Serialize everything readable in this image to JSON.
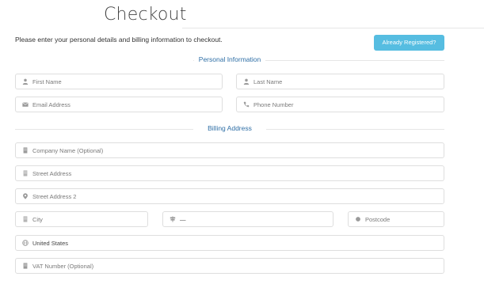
{
  "page": {
    "title": "Checkout",
    "intro": "Please enter your personal details and billing information to checkout.",
    "registered_button": "Already Registered?"
  },
  "sections": {
    "personal": "Personal Information",
    "billing": "Billing Address"
  },
  "fields": {
    "first_name": {
      "placeholder": "First Name",
      "icon": "user-icon"
    },
    "last_name": {
      "placeholder": "Last Name",
      "icon": "user-icon"
    },
    "email": {
      "placeholder": "Email Address",
      "icon": "envelope-icon"
    },
    "phone": {
      "placeholder": "Phone Number",
      "icon": "phone-icon"
    },
    "company": {
      "placeholder": "Company Name (Optional)",
      "icon": "building-icon"
    },
    "street": {
      "placeholder": "Street Address",
      "icon": "building-icon"
    },
    "street2": {
      "placeholder": "Street Address 2",
      "icon": "map-pin-icon"
    },
    "city": {
      "placeholder": "City",
      "icon": "building-icon"
    },
    "state": {
      "value": "—",
      "icon": "signpost-icon"
    },
    "postcode": {
      "placeholder": "Postcode",
      "icon": "dot-icon"
    },
    "country": {
      "value": "United States",
      "icon": "globe-icon"
    },
    "vat": {
      "placeholder": "VAT Number (Optional)",
      "icon": "building-icon"
    }
  },
  "colors": {
    "accent_button": "#56bde1",
    "section_label": "#2f6fa6",
    "field_border": "#dedede"
  }
}
